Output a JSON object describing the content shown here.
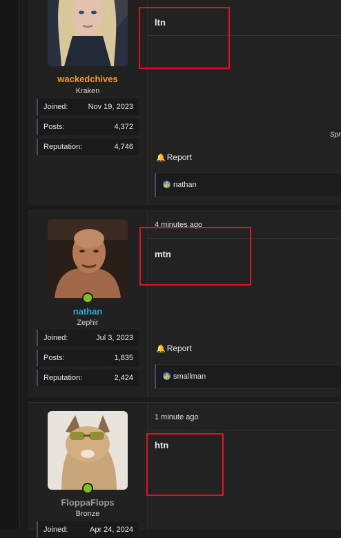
{
  "posts": [
    {
      "username": "wackedchives",
      "username_color": "#f0a020",
      "user_title": "Kraken",
      "stats": [
        {
          "label": "Joined:",
          "value": "Nov 19, 2023"
        },
        {
          "label": "Posts:",
          "value": "4,372"
        },
        {
          "label": "Reputation:",
          "value": "4,746"
        }
      ],
      "message": "ltn",
      "report_label": "Report",
      "reaction_users": "nathan",
      "signature_fragment": "Spr"
    },
    {
      "date": "4 minutes ago",
      "username": "nathan",
      "username_color": "#2aa8d8",
      "user_title": "Zephir",
      "stats": [
        {
          "label": "Joined:",
          "value": "Jul 3, 2023"
        },
        {
          "label": "Posts:",
          "value": "1,835"
        },
        {
          "label": "Reputation:",
          "value": "2,424"
        }
      ],
      "message": "mtn",
      "report_label": "Report",
      "reaction_users": "smallman"
    },
    {
      "date": "1 minute ago",
      "username": "FloppaFlops",
      "username_color": "#9a9a9a",
      "user_title": "Bronze",
      "stats": [
        {
          "label": "Joined:",
          "value": "Apr 24, 2024"
        }
      ],
      "message": "htn"
    }
  ],
  "icons": {
    "report": "bell-icon",
    "reaction": "thumbs-up-icon",
    "online": "online-dot-icon"
  }
}
